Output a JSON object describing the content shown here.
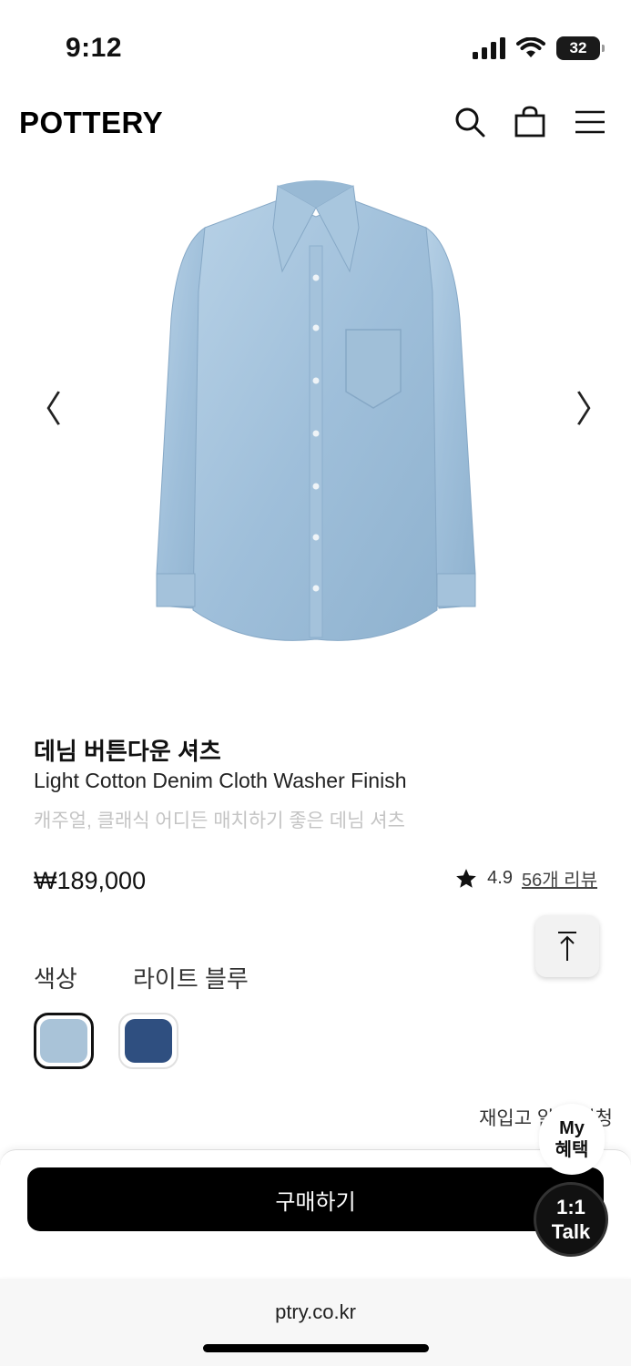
{
  "status_bar": {
    "time": "9:12",
    "battery": "32"
  },
  "header": {
    "logo": "POTTERY",
    "icons": [
      "search-icon",
      "shopping-bag-icon",
      "menu-icon"
    ]
  },
  "product": {
    "name": "데님 버튼다운 셔츠",
    "subtitle": "Light Cotton Denim Cloth Washer Finish",
    "description": "캐주얼, 클래식 어디든 매치하기 좋은 데님 셔츠",
    "price": "₩189,000",
    "rating": "4.9",
    "review_link": "56개 리뷰"
  },
  "carousel": {
    "prev": "〈",
    "next": "〉"
  },
  "color": {
    "label": "색상",
    "selected": "라이트 블루",
    "swatches": [
      {
        "name": "light-blue",
        "hex": "#a9c3d8",
        "selected": true
      },
      {
        "name": "navy",
        "hex": "#2f4f80",
        "selected": false
      }
    ]
  },
  "restock": "재입고 알림 신청",
  "buy_button": "구매하기",
  "floating": {
    "my_line1": "My",
    "my_line2": "혜택",
    "talk_line1": "1:1",
    "talk_line2": "Talk"
  },
  "browser": {
    "url": "ptry.co.kr"
  },
  "colors": {
    "accent": "#000000",
    "muted_text": "#c4c4c4"
  }
}
